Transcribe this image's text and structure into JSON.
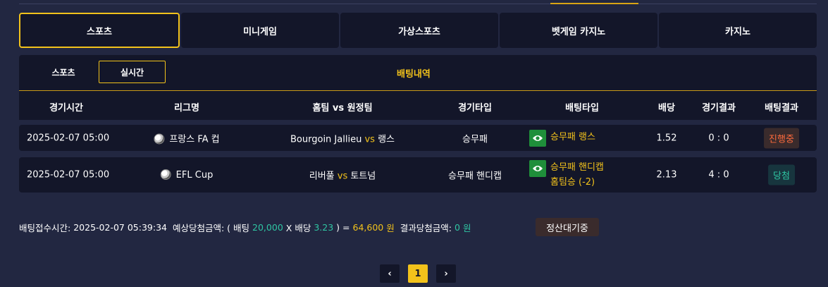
{
  "game_tabs": [
    "스포츠",
    "미니게임",
    "가상스포츠",
    "벳게임 카지노",
    "카지노"
  ],
  "sub_tabs": [
    "스포츠",
    "실시간"
  ],
  "panel_title": "배팅내역",
  "columns": [
    "경기시간",
    "리그명",
    "홈팀 vs 원정팀",
    "경기타입",
    "배팅타입",
    "배당",
    "경기결과",
    "배팅결과"
  ],
  "rows": [
    {
      "time": "2025-02-07 05:00",
      "league": "프랑스 FA 컵",
      "home": "Bourgoin Jallieu",
      "vs": "vs",
      "away": "랭스",
      "game_type": "승무패",
      "bet_line1": "승무패 랭스",
      "bet_line2": "",
      "odds": "1.52",
      "score": "0 : 0",
      "result": "진행중"
    },
    {
      "time": "2025-02-07 05:00",
      "league": "EFL Cup",
      "home": "리버풀",
      "vs": "vs",
      "away": "토트넘",
      "game_type": "승무패 핸디캡",
      "bet_line1": "승무패 핸디캡",
      "bet_line2": "홈팀승 (-2)",
      "odds": "2.13",
      "score": "4 : 0",
      "result": "당첨"
    }
  ],
  "summary": {
    "received_label": "배팅접수시간:",
    "received_time": "2025-02-07 05:39:34",
    "expected_label": "예상당첨금액: ( 배팅",
    "bet_amount": "20,000",
    "x_label": "X 배당",
    "total_odds": "3.23",
    "eq_label": ") =",
    "expected_amount": "64,600",
    "won_unit": "원",
    "result_label": "결과당첨금액:",
    "result_amount": "0",
    "result_unit": "원",
    "status_button": "정산대기중"
  },
  "pagination": {
    "prev": "‹",
    "current": "1",
    "next": "›"
  },
  "colors": {
    "accent": "#f2c21b",
    "panel": "#131629",
    "background": "#222741",
    "win": "#2fc6a3",
    "pending": "#ff6b3d"
  },
  "icons": [
    "eye-icon",
    "soccer-ball-icon",
    "chevron-left-icon",
    "chevron-right-icon"
  ]
}
